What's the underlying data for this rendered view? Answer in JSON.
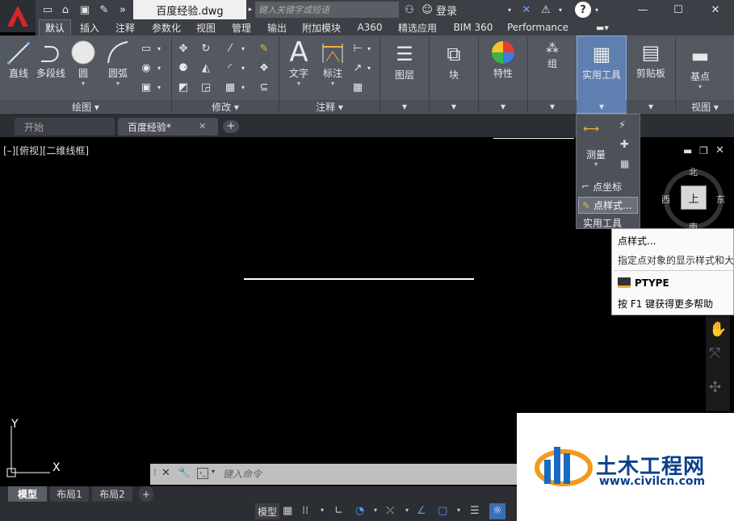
{
  "app": {
    "logo": "A"
  },
  "titlebar": {
    "document_title": "百度经验.dwg",
    "search_placeholder": "键入关键字或短语",
    "login_label": "登录",
    "help_icon": "?",
    "minimize": "—",
    "maximize": "☐",
    "close": "✕"
  },
  "ribbon_tabs": [
    "默认",
    "插入",
    "注释",
    "参数化",
    "视图",
    "管理",
    "输出",
    "附加模块",
    "A360",
    "精选应用",
    "BIM 360",
    "Performance"
  ],
  "ribbon": {
    "draw": {
      "line": "直线",
      "polyline": "多段线",
      "circle": "圆",
      "arc": "圆弧",
      "panel_title": "绘图 ▾"
    },
    "modify": {
      "panel_title": "修改 ▾"
    },
    "annotation": {
      "text": "文字",
      "dimension": "标注",
      "panel_title": "注释 ▾"
    },
    "layers": "图层",
    "block": "块",
    "properties": "特性",
    "groups": "组",
    "utilities": "实用工具",
    "clipboard": "剪贴板",
    "view": {
      "base": "基点",
      "panel_title": "视图 ▾"
    }
  },
  "file_tabs": {
    "start": "开始",
    "current": "百度经验*",
    "add": "+"
  },
  "viewport": {
    "label": "[–][俯视][二维线框]"
  },
  "utilities_dropdown": {
    "measure": "测量",
    "point_coords": "点坐标",
    "point_style": "点样式...",
    "panel_title": "实用工具"
  },
  "tooltip": {
    "title": "点样式...",
    "description": "指定点对象的显示样式和大",
    "command": "PTYPE",
    "help": "按 F1 键获得更多帮助"
  },
  "viewcube": {
    "north": "北",
    "south": "南",
    "east": "东",
    "west": "西",
    "face": "上"
  },
  "ucs": {
    "x": "X",
    "y": "Y"
  },
  "command_line": {
    "placeholder": "键入命令"
  },
  "layout_tabs": [
    "模型",
    "布局1",
    "布局2"
  ],
  "status": {
    "model": "模型"
  },
  "watermark": {
    "brand": "土木工程网",
    "url": "www.civilcn.com"
  }
}
